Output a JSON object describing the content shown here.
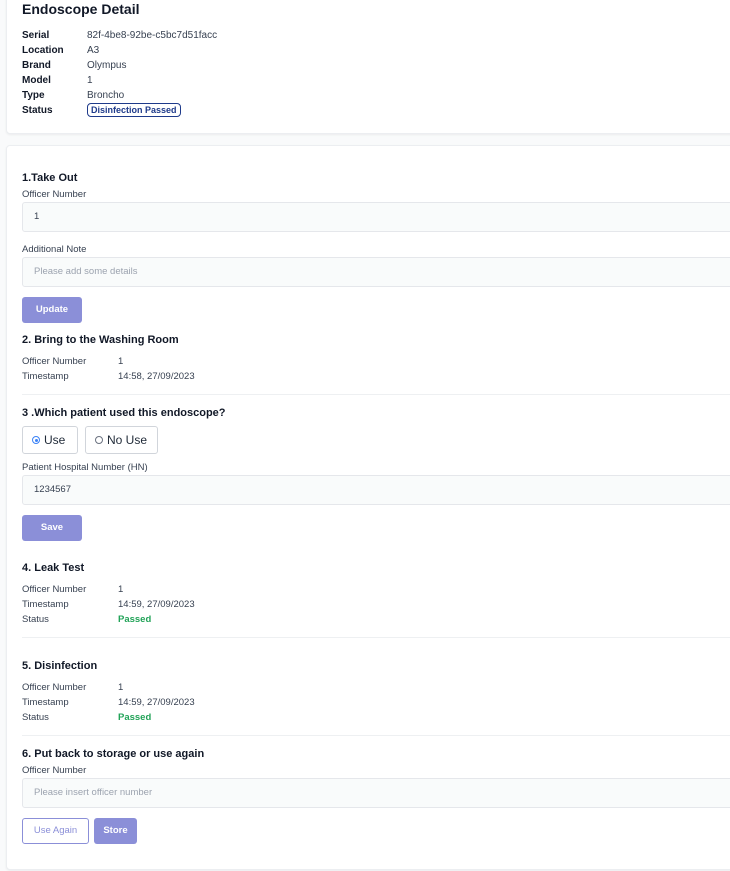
{
  "header": {
    "title": "Endoscope Detail"
  },
  "details": {
    "serial_label": "Serial",
    "serial": "82f-4be8-92be-c5bc7d51facc",
    "location_label": "Location",
    "location": "A3",
    "brand_label": "Brand",
    "brand": "Olympus",
    "model_label": "Model",
    "model": "1",
    "type_label": "Type",
    "type": "Broncho",
    "status_label": "Status",
    "status": "Disinfection Passed"
  },
  "take_out": {
    "title": "1.Take Out",
    "officer_label": "Officer Number",
    "officer_value": "1",
    "note_label": "Additional Note",
    "note_placeholder": "Please add some details",
    "update_label": "Update"
  },
  "washing": {
    "title": "2. Bring to the Washing Room",
    "officer_label": "Officer Number",
    "officer_value": "1",
    "timestamp_label": "Timestamp",
    "timestamp_value": "14:58, 27/09/2023"
  },
  "patient": {
    "title": "3 .Which patient used this endoscope?",
    "use_label": "Use",
    "no_use_label": "No Use",
    "selected": "Use",
    "hn_label": "Patient Hospital Number (HN)",
    "hn_value": "1234567",
    "save_label": "Save"
  },
  "leak_test": {
    "title": "4. Leak Test",
    "officer_label": "Officer Number",
    "officer_value": "1",
    "timestamp_label": "Timestamp",
    "timestamp_value": "14:59, 27/09/2023",
    "status_label": "Status",
    "status_value": "Passed"
  },
  "disinfection": {
    "title": "5. Disinfection",
    "officer_label": "Officer Number",
    "officer_value": "1",
    "timestamp_label": "Timestamp",
    "timestamp_value": "14:59, 27/09/2023",
    "status_label": "Status",
    "status_value": "Passed"
  },
  "storage": {
    "title": "6. Put back to storage or use again",
    "officer_label": "Officer Number",
    "officer_placeholder": "Please insert officer number",
    "use_again_label": "Use Again",
    "store_label": "Store"
  },
  "colors": {
    "accent": "#8b8fd8",
    "passed": "#22a358",
    "badge": "#1e3a8a"
  }
}
